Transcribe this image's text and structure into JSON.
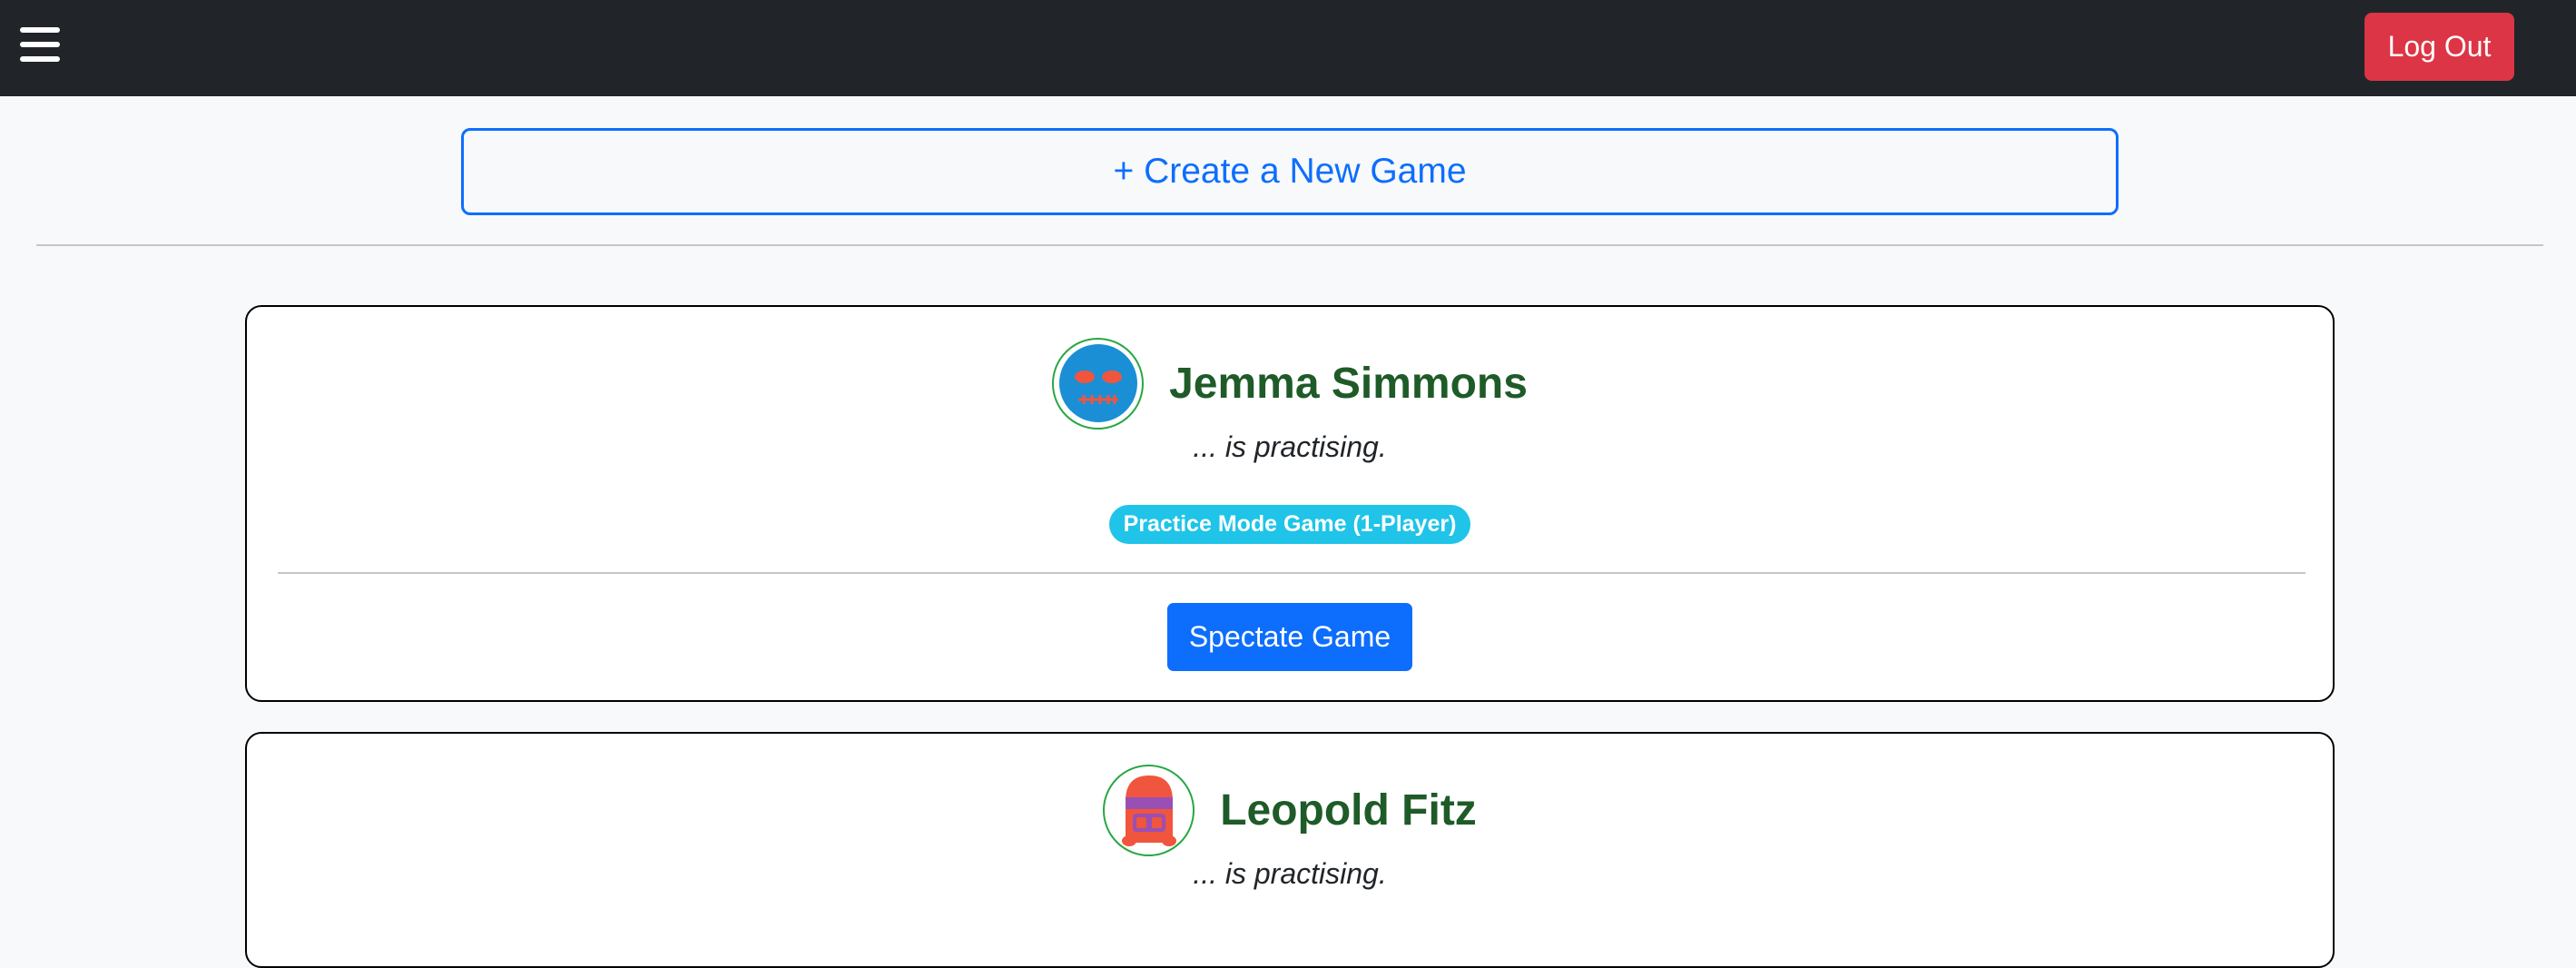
{
  "navbar": {
    "menu_icon": "hamburger-menu-icon",
    "logout_label": "Log Out",
    "logout_color": "#dc3545"
  },
  "create_game": {
    "label": "+ Create a New Game",
    "color": "#0d6efd"
  },
  "games": [
    {
      "player_name": "Jemma Simmons",
      "avatar_icon": "blue-masked-avatar-icon",
      "status": "... is practising.",
      "badge": "Practice Mode Game (1-Player)",
      "action_label": "Spectate Game"
    },
    {
      "player_name": "Leopold Fitz",
      "avatar_icon": "red-hooded-avatar-icon",
      "status": "... is practising."
    }
  ],
  "colors": {
    "navbar_bg": "#212529",
    "player_name": "#1e5b28",
    "badge_bg": "#1fc4e8",
    "spectate_bg": "#0d6efd"
  }
}
